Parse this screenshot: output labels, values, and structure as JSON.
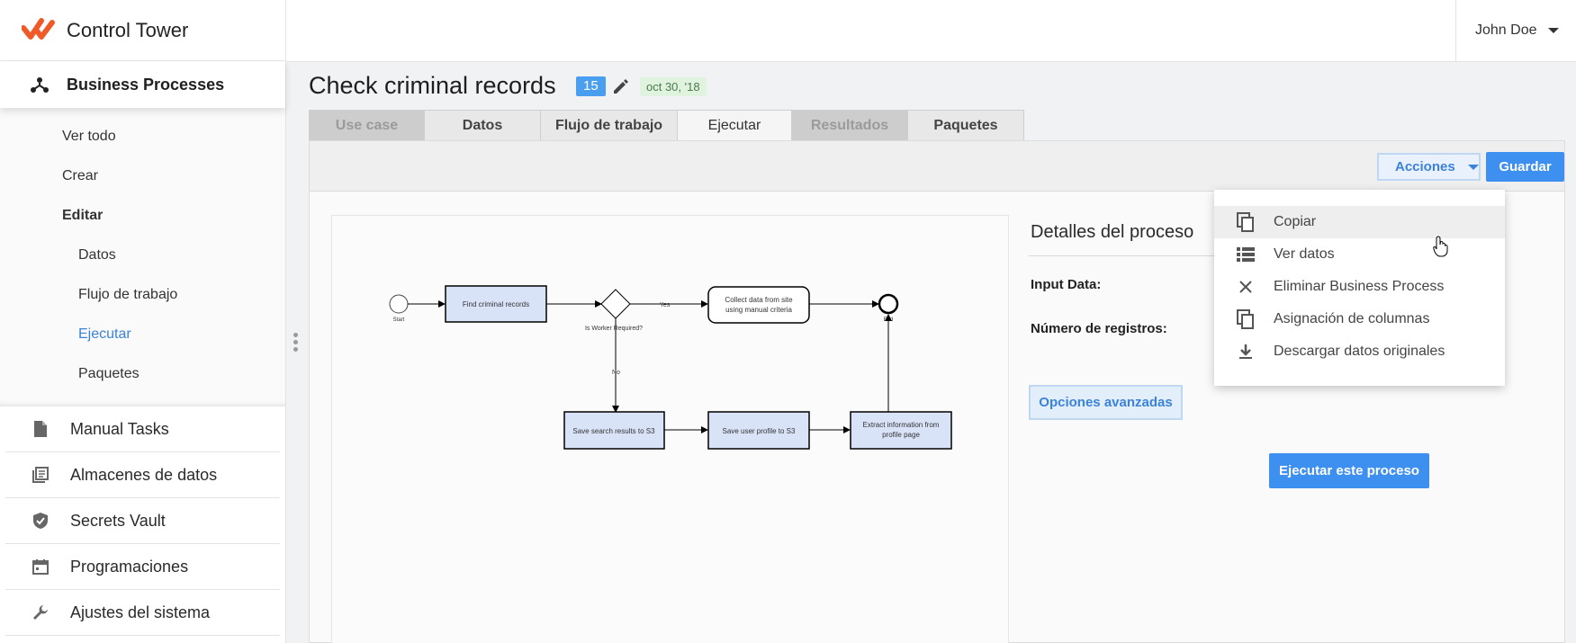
{
  "app": {
    "title": "Control Tower"
  },
  "user": {
    "name": "John Doe"
  },
  "sidebar": {
    "section": {
      "label": "Business Processes",
      "icon": "hub-icon"
    },
    "subitems": [
      {
        "label": "Ver todo",
        "level": 1
      },
      {
        "label": "Crear",
        "level": 1
      },
      {
        "label": "Editar",
        "level": 1,
        "bold": true
      },
      {
        "label": "Datos",
        "level": 2
      },
      {
        "label": "Flujo de trabajo",
        "level": 2
      },
      {
        "label": "Ejecutar",
        "level": 2,
        "active": true
      },
      {
        "label": "Paquetes",
        "level": 2
      }
    ],
    "items": [
      {
        "label": "Manual Tasks",
        "icon": "document-icon"
      },
      {
        "label": "Almacenes de datos",
        "icon": "library-icon"
      },
      {
        "label": "Secrets Vault",
        "icon": "shield-icon"
      },
      {
        "label": "Programaciones",
        "icon": "calendar-icon"
      },
      {
        "label": "Ajustes del sistema",
        "icon": "wrench-icon"
      }
    ]
  },
  "header": {
    "title": "Check criminal records",
    "count": "15",
    "date": "oct 30, '18"
  },
  "tabs": [
    {
      "label": "Use case",
      "state": "disabled"
    },
    {
      "label": "Datos",
      "state": "normal"
    },
    {
      "label": "Flujo de trabajo",
      "state": "normal"
    },
    {
      "label": "Ejecutar",
      "state": "active"
    },
    {
      "label": "Resultados",
      "state": "disabled"
    },
    {
      "label": "Paquetes",
      "state": "normal"
    }
  ],
  "toolbar": {
    "actions_label": "Acciones",
    "save_label": "Guardar"
  },
  "actions_menu": [
    {
      "label": "Copiar",
      "icon": "copy-icon",
      "hover": true
    },
    {
      "label": "Ver datos",
      "icon": "list-icon"
    },
    {
      "label": "Eliminar Business Process",
      "icon": "close-icon"
    },
    {
      "label": "Asignación de columnas",
      "icon": "copy-icon"
    },
    {
      "label": "Descargar datos originales",
      "icon": "download-icon"
    }
  ],
  "diagram": {
    "start": "Start",
    "end": "End",
    "gateway": "Is Worker Required?",
    "yes": "Yes",
    "no": "No",
    "tasks": {
      "find": "Find criminal records",
      "collect_1": "Collect data from site",
      "collect_2": "using manual criteria",
      "save_search": "Save search results to S3",
      "save_profile": "Save user profile to S3",
      "extract_1": "Extract information from",
      "extract_2": "profile page"
    }
  },
  "details": {
    "title": "Detalles del proceso",
    "input_label": "Input Data:",
    "records_label": "Número de registros:",
    "advanced_button": "Opciones avanzadas",
    "run_button": "Ejecutar este proceso"
  },
  "colors": {
    "accent": "#3d8ff0",
    "logo": "#f05a28",
    "task_fill": "#d9e3f8",
    "badge": "#4a9ef0",
    "date_badge": "#dff3df"
  }
}
